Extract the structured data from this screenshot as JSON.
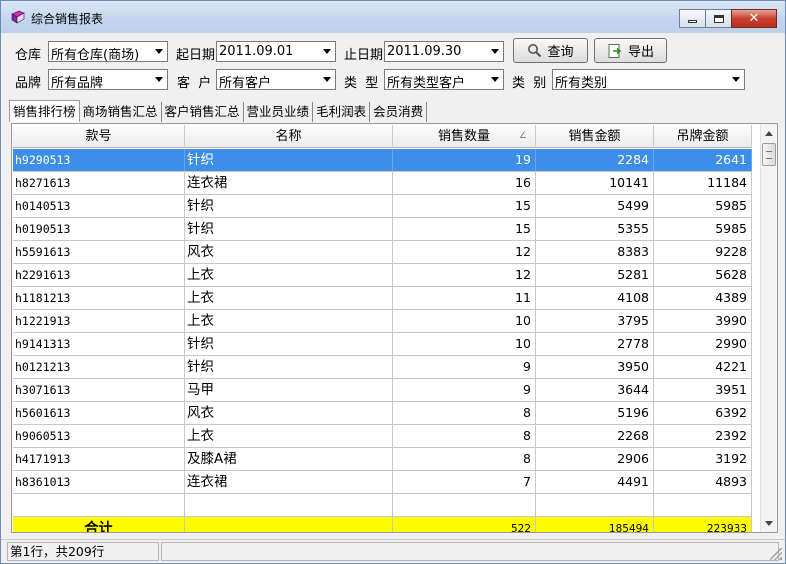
{
  "window": {
    "title": "综合销售报表",
    "close_glyph": "✕"
  },
  "filters": {
    "warehouse": {
      "label": "仓库",
      "value": "所有仓库(商场)"
    },
    "start_date": {
      "label": "起日期",
      "value": "2011.09.01"
    },
    "end_date": {
      "label": "止日期",
      "value": "2011.09.30"
    },
    "brand": {
      "label": "品牌",
      "value": "所有品牌"
    },
    "customer": {
      "label": "客  户",
      "value": "所有客户"
    },
    "type": {
      "label": "类  型",
      "value": "所有类型客户"
    },
    "category": {
      "label": "类  别",
      "value": "所有类别"
    }
  },
  "toolbar": {
    "query_label": "查询",
    "export_label": "导出"
  },
  "tabs": [
    "销售排行榜",
    "商场销售汇总",
    "客户销售汇总",
    "营业员业绩",
    "毛利润表",
    "会员消费"
  ],
  "table": {
    "columns": [
      "款号",
      "名称",
      "销售数量",
      "销售金额",
      "吊牌金额"
    ],
    "sort_indicator": "∠",
    "rows": [
      [
        "h9290513",
        "针织",
        "19",
        "2284",
        "2641"
      ],
      [
        "h8271613",
        "连衣裙",
        "16",
        "10141",
        "11184"
      ],
      [
        "h0140513",
        "针织",
        "15",
        "5499",
        "5985"
      ],
      [
        "h0190513",
        "针织",
        "15",
        "5355",
        "5985"
      ],
      [
        "h5591613",
        "风衣",
        "12",
        "8383",
        "9228"
      ],
      [
        "h2291613",
        "上衣",
        "12",
        "5281",
        "5628"
      ],
      [
        "h1181213",
        "上衣",
        "11",
        "4108",
        "4389"
      ],
      [
        "h1221913",
        "上衣",
        "10",
        "3795",
        "3990"
      ],
      [
        "h9141313",
        "针织",
        "10",
        "2778",
        "2990"
      ],
      [
        "h0121213",
        "针织",
        "9",
        "3950",
        "4221"
      ],
      [
        "h3071613",
        "马甲",
        "9",
        "3644",
        "3951"
      ],
      [
        "h5601613",
        "风衣",
        "8",
        "5196",
        "6392"
      ],
      [
        "h9060513",
        "上衣",
        "8",
        "2268",
        "2392"
      ],
      [
        "h4171913",
        "及膝A裙",
        "8",
        "2906",
        "3192"
      ],
      [
        "h8361013",
        "连衣裙",
        "7",
        "4491",
        "4893"
      ]
    ],
    "total": {
      "label": "合计",
      "quantity": "522",
      "sales": "185494",
      "tag": "223933"
    }
  },
  "status": {
    "text": "第1行，共209行"
  },
  "colors": {
    "selected_row": "#3d8ee8",
    "total_row": "#fdfd00",
    "title_bar": "#c4d6ee"
  }
}
